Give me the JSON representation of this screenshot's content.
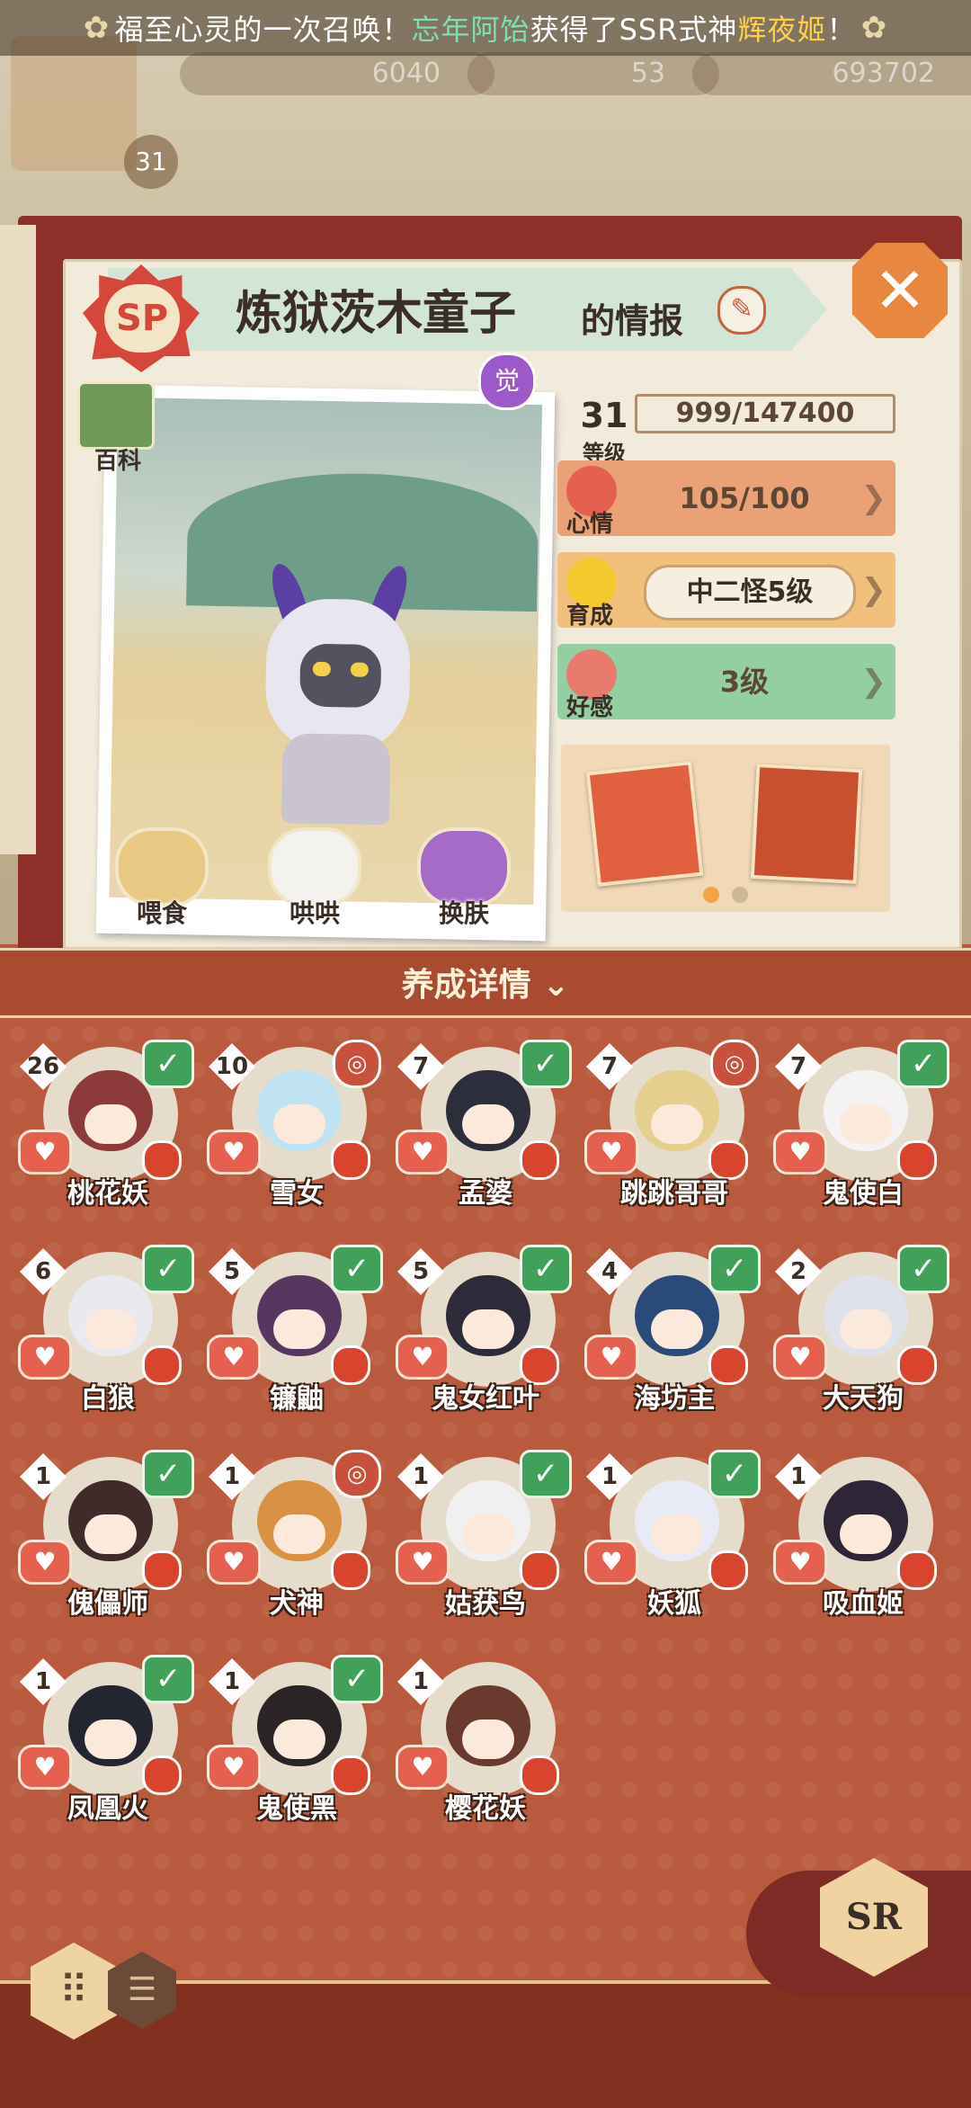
{
  "banner": {
    "prefix": "福至心灵的一次召唤！",
    "player": "忘年阿饴",
    "middle": "获得了SSR式神",
    "shikigami": "辉夜姬",
    "suffix": "！"
  },
  "resources": {
    "value1": "6040",
    "value2": "53",
    "value3": "693702",
    "player_level": "31"
  },
  "header": {
    "badge": "SP",
    "name": "炼狱茨木童子",
    "suffix": "的情报"
  },
  "portrait": {
    "wiki_label": "百科",
    "awaken_label": "觉",
    "actions": [
      {
        "label": "喂食"
      },
      {
        "label": "哄哄"
      },
      {
        "label": "换肤"
      }
    ]
  },
  "stats": {
    "level_value": "31",
    "level_label": "等级",
    "exp_text": "999/147400",
    "mood_label": "心情",
    "mood_value": "105/100",
    "growth_label": "育成",
    "growth_value": "中二怪5级",
    "affinity_label": "好感",
    "affinity_value": "3级"
  },
  "section": {
    "title": "养成详情"
  },
  "shikigami": [
    {
      "level": "26",
      "name": "桃花妖",
      "status": "check"
    },
    {
      "level": "10",
      "name": "雪女",
      "status": "bell"
    },
    {
      "level": "7",
      "name": "孟婆",
      "status": "check"
    },
    {
      "level": "7",
      "name": "跳跳哥哥",
      "status": "bell"
    },
    {
      "level": "7",
      "name": "鬼使白",
      "status": "check"
    },
    {
      "level": "6",
      "name": "白狼",
      "status": "check"
    },
    {
      "level": "5",
      "name": "镰鼬",
      "status": "check"
    },
    {
      "level": "5",
      "name": "鬼女红叶",
      "status": "check"
    },
    {
      "level": "4",
      "name": "海坊主",
      "status": "check"
    },
    {
      "level": "2",
      "name": "大天狗",
      "status": "check"
    },
    {
      "level": "1",
      "name": "傀儡师",
      "status": "check"
    },
    {
      "level": "1",
      "name": "犬神",
      "status": "bell"
    },
    {
      "level": "1",
      "name": "姑获鸟",
      "status": "check"
    },
    {
      "level": "1",
      "name": "妖狐",
      "status": "check"
    },
    {
      "level": "1",
      "name": "吸血姬",
      "status": "none"
    },
    {
      "level": "1",
      "name": "凤凰火",
      "status": "check"
    },
    {
      "level": "1",
      "name": "鬼使黑",
      "status": "check"
    },
    {
      "level": "1",
      "name": "樱花妖",
      "status": "none"
    }
  ],
  "footer": {
    "rarity_tab": "SR",
    "grid_view_icon": "grid-icon",
    "list_view_icon": "list-icon"
  },
  "colors": {
    "check": "#41a05a",
    "notice": "#d9442e",
    "panel_red": "#b95a3e"
  }
}
